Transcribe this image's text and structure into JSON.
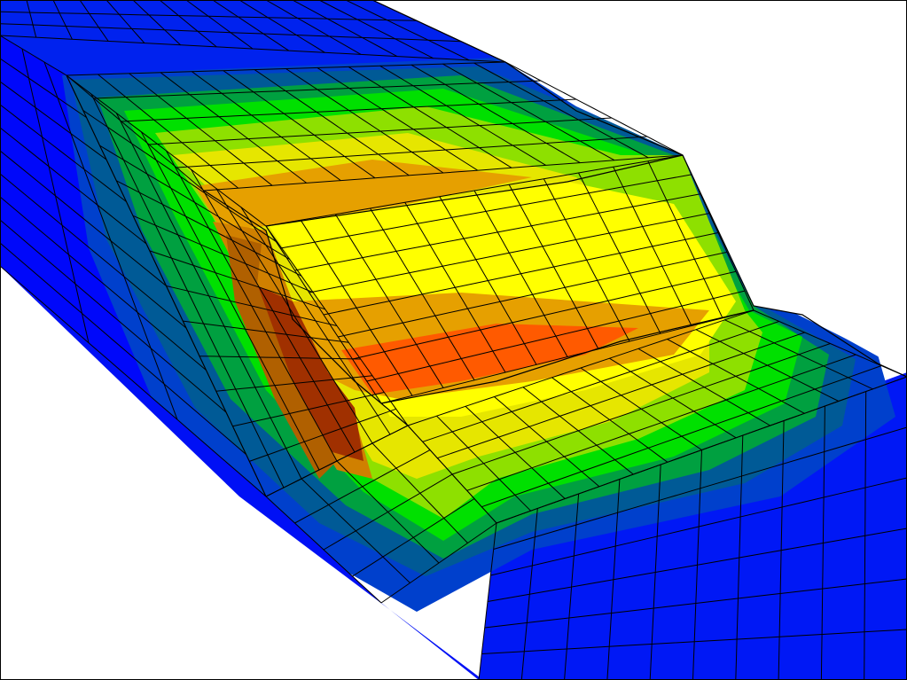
{
  "colors": {
    "background": "#ffffff",
    "mesh_lines": "#000000",
    "frame": "#000000"
  },
  "contour_palette": [
    "#0000ff",
    "#0040cc",
    "#005a96",
    "#00a040",
    "#00e000",
    "#8ee000",
    "#e6e600",
    "#ffff00",
    "#e6a000",
    "#ff5a00",
    "#a03000"
  ],
  "scene": {
    "description_visible_text": ""
  }
}
